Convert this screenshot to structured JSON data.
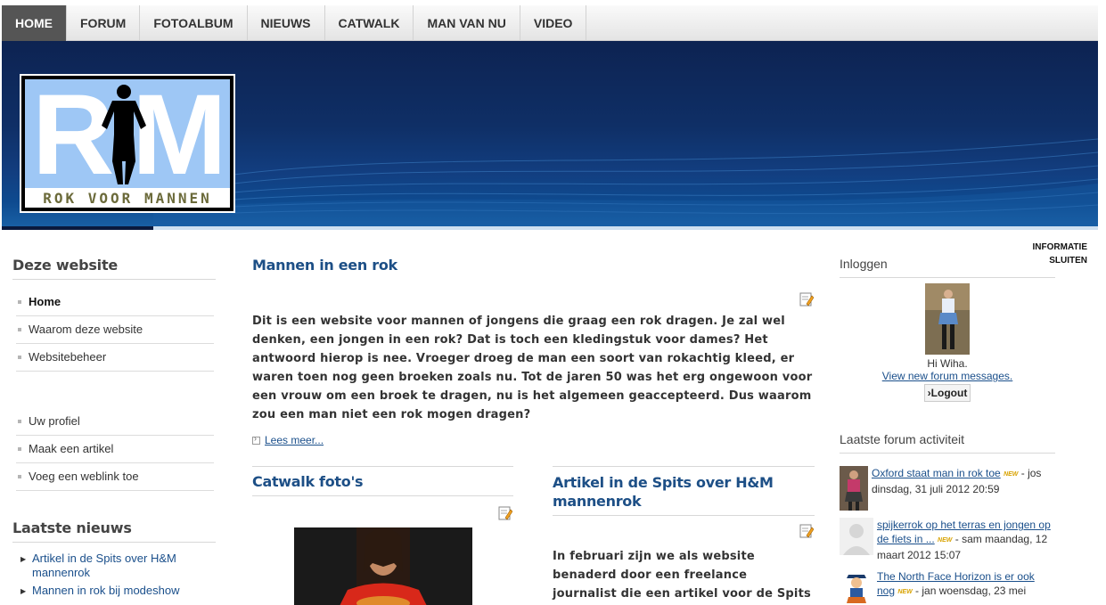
{
  "nav": [
    "HOME",
    "FORUM",
    "FOTOALBUM",
    "NIEUWS",
    "CATWALK",
    "MAN VAN NU",
    "VIDEO"
  ],
  "logo": {
    "text": "ROK VOOR MANNEN",
    "letters": "RM"
  },
  "info_close": [
    "INFORMATIE",
    "SLUITEN"
  ],
  "left": {
    "site_title": "Deze website",
    "menu1": [
      "Home",
      "Waarom deze website",
      "Websitebeheer"
    ],
    "menu2": [
      "Uw profiel",
      "Maak een artikel",
      "Voeg een weblink toe"
    ],
    "news_title": "Laatste nieuws",
    "news": [
      "Artikel in de Spits over H&M mannenrok",
      "Mannen in rok bij modeshow"
    ]
  },
  "main": {
    "title": "Mannen in een rok",
    "intro": "Dit is een website voor mannen of jongens die graag een rok dragen. Je zal wel denken, een jongen in een rok? Dat is toch een kledingstuk voor dames? Het antwoord hierop is nee. Vroeger droeg de man een soort van rokachtig kleed, er waren toen nog geen broeken zoals nu. Tot de jaren 50 was het erg ongewoon voor een vrouw om een broek te dragen, nu is het algemeen geaccepteerd. Dus waarom zou een man niet een rok mogen dragen?",
    "readmore": "Lees meer...",
    "sub1_title": "Catwalk foto's",
    "sub2_title": "Artikel in de Spits over H&M mannenrok",
    "sub2_text": "In februari zijn we als website benaderd door een freelance journalist die een artikel voor de Spits ging schrijven over"
  },
  "right": {
    "login_title": "Inloggen",
    "greeting": "Hi Wiha.",
    "forum_link": "View new forum messages.",
    "logout": "Logout",
    "forum_title": "Laatste forum activiteit",
    "new_badge": "NEW",
    "forum": [
      {
        "topic": "Oxford staat man in rok toe",
        "meta": "jos dinsdag, 31 juli 2012 20:59"
      },
      {
        "topic": "spijkerrok op het terras en jongen op de fiets in ...",
        "meta": "sam maandag, 12 maart 2012 15:07"
      },
      {
        "topic": "The North Face Horizon is er ook nog",
        "meta": "jan woensdag, 23 mei"
      }
    ]
  }
}
